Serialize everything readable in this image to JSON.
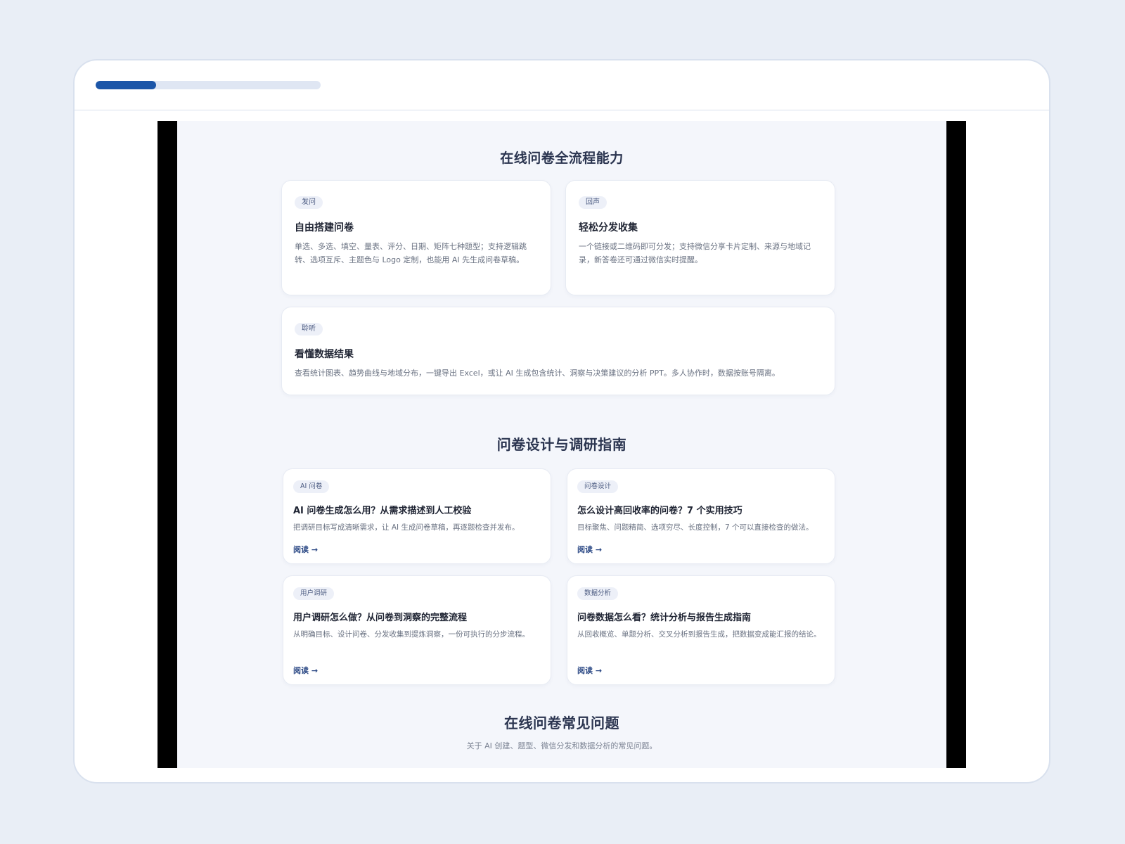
{
  "progress": {
    "value": 0.27
  },
  "features": {
    "title": "在线问卷全流程能力",
    "cards": [
      {
        "tag": "发问",
        "title": "自由搭建问卷",
        "desc": "单选、多选、填空、量表、评分、日期、矩阵七种题型；支持逻辑跳转、选项互斥、主题色与 Logo 定制，也能用 AI 先生成问卷草稿。"
      },
      {
        "tag": "回声",
        "title": "轻松分发收集",
        "desc": "一个链接或二维码即可分发；支持微信分享卡片定制、来源与地域记录，新答卷还可通过微信实时提醒。"
      },
      {
        "tag": "聆听",
        "title": "看懂数据结果",
        "desc": "查看统计图表、趋势曲线与地域分布，一键导出 Excel，或让 AI 生成包含统计、洞察与决策建议的分析 PPT。多人协作时，数据按账号隔离。"
      }
    ]
  },
  "guides": {
    "title": "问卷设计与调研指南",
    "read_label": "阅读 →",
    "cards": [
      {
        "tag": "AI 问卷",
        "title": "AI 问卷生成怎么用？从需求描述到人工校验",
        "desc": "把调研目标写成清晰需求，让 AI 生成问卷草稿，再逐题检查并发布。"
      },
      {
        "tag": "问卷设计",
        "title": "怎么设计高回收率的问卷？7 个实用技巧",
        "desc": "目标聚焦、问题精简、选项穷尽、长度控制，7 个可以直接检查的做法。"
      },
      {
        "tag": "用户调研",
        "title": "用户调研怎么做？从问卷到洞察的完整流程",
        "desc": "从明确目标、设计问卷、分发收集到提炼洞察，一份可执行的分步流程。"
      },
      {
        "tag": "数据分析",
        "title": "问卷数据怎么看？统计分析与报告生成指南",
        "desc": "从回收概览、单题分析、交叉分析到报告生成，把数据变成能汇报的结论。"
      }
    ]
  },
  "faq": {
    "title": "在线问卷常见问题",
    "subtitle": "关于 AI 创建、题型、微信分发和数据分析的常见问题。"
  }
}
